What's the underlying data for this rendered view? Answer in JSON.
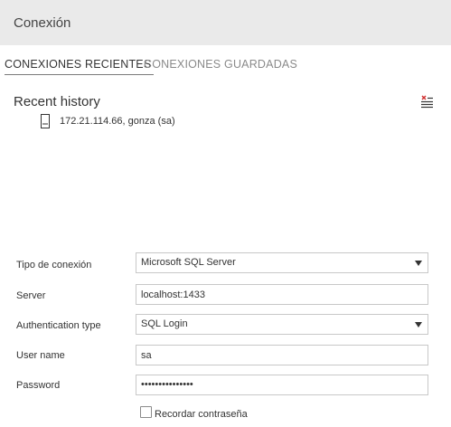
{
  "header": {
    "title": "Conexión"
  },
  "tabs": [
    {
      "label": "CONEXIONES RECIENTES",
      "active": true
    },
    {
      "label": "CONEXIONES GUARDADAS",
      "active": false
    }
  ],
  "recent": {
    "title": "Recent history",
    "clear_icon": "clear-list-icon",
    "items": [
      {
        "label": "172.21.114.66, gonza (sa)",
        "icon": "database-file-icon"
      }
    ]
  },
  "form": {
    "connection_type": {
      "label": "Tipo de conexión",
      "value": "Microsoft SQL Server"
    },
    "server": {
      "label": "Server",
      "value": "localhost:1433"
    },
    "auth_type": {
      "label": "Authentication type",
      "value": "SQL Login"
    },
    "user_name": {
      "label": "User name",
      "value": "sa"
    },
    "password": {
      "label": "Password",
      "value": "•••••••••••••••"
    },
    "remember": {
      "label": "Recordar contraseña",
      "checked": false
    }
  }
}
